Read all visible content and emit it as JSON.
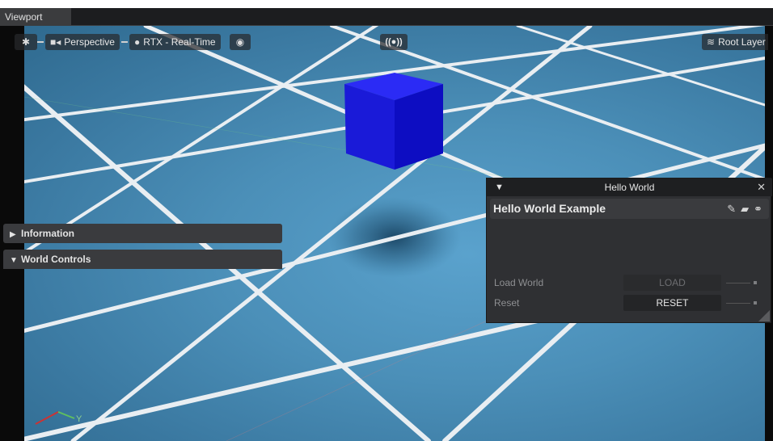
{
  "window": {
    "tab_label": "Viewport"
  },
  "toolbar": {
    "camera_label": "Perspective",
    "render_label": "RTX - Real-Time",
    "broadcast_label": "((●))",
    "layer_label": "Root Layer"
  },
  "scene": {
    "cube_color": "#1414e6",
    "grid_color": "#e9eef2"
  },
  "panel": {
    "title": "Hello World",
    "close_glyph": "✕",
    "collapse_glyph": "▼",
    "extension_name": "Hello World Example",
    "sections": [
      {
        "label": "Information",
        "state": "collapsed"
      },
      {
        "label": "World Controls",
        "state": "expanded"
      }
    ],
    "rows": [
      {
        "label": "Load World",
        "button": "LOAD",
        "enabled": false
      },
      {
        "label": "Reset",
        "button": "RESET",
        "enabled": true
      }
    ]
  },
  "axis": {
    "y_label": "Y"
  }
}
